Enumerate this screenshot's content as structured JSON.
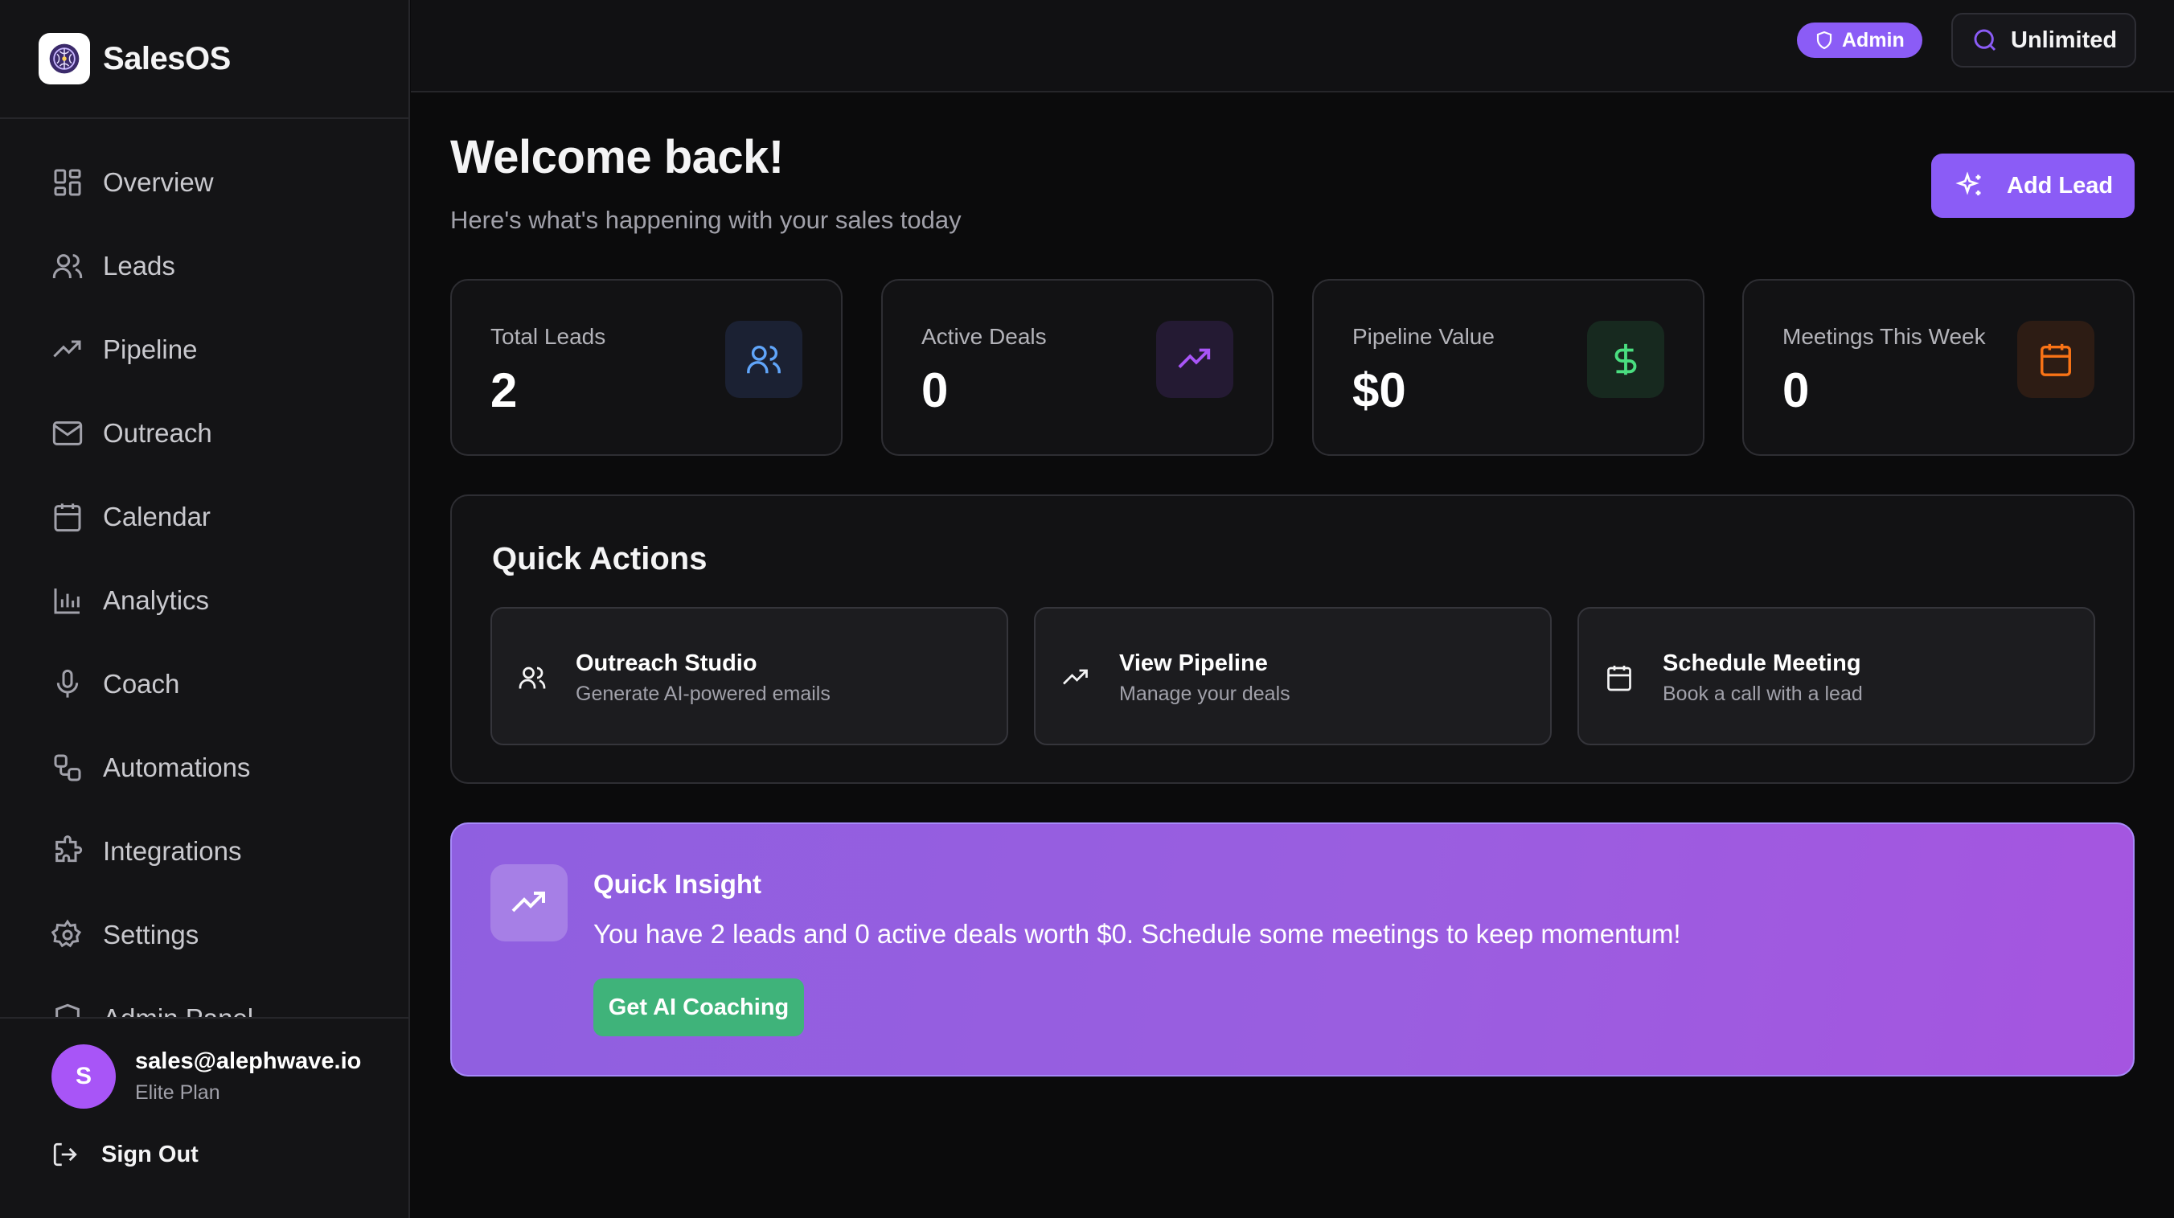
{
  "brand": {
    "name": "SalesOS",
    "logo_icon": "brain-logo-icon"
  },
  "sidebar": {
    "items": [
      {
        "label": "Overview",
        "icon": "grid-icon"
      },
      {
        "label": "Leads",
        "icon": "users-icon"
      },
      {
        "label": "Pipeline",
        "icon": "trending-up-icon"
      },
      {
        "label": "Outreach",
        "icon": "mail-icon"
      },
      {
        "label": "Calendar",
        "icon": "calendar-icon"
      },
      {
        "label": "Analytics",
        "icon": "bar-chart-icon"
      },
      {
        "label": "Coach",
        "icon": "microphone-icon"
      },
      {
        "label": "Automations",
        "icon": "workflow-icon"
      },
      {
        "label": "Integrations",
        "icon": "puzzle-icon"
      },
      {
        "label": "Settings",
        "icon": "gear-icon"
      },
      {
        "label": "Admin Panel",
        "icon": "shield-icon"
      }
    ]
  },
  "user": {
    "avatar_initial": "S",
    "email": "sales@alephwave.io",
    "plan": "Elite Plan"
  },
  "signout_label": "Sign Out",
  "topbar": {
    "admin_badge": "Admin",
    "unlimited_label": "Unlimited"
  },
  "header": {
    "title": "Welcome back!",
    "subtitle": "Here's what's happening with your sales today",
    "add_lead_label": "Add Lead"
  },
  "stats": [
    {
      "label": "Total Leads",
      "value": "2",
      "icon": "users-icon",
      "color": "#60a5fa"
    },
    {
      "label": "Active Deals",
      "value": "0",
      "icon": "trending-up-icon",
      "color": "#a855f7"
    },
    {
      "label": "Pipeline Value",
      "value": "$0",
      "icon": "dollar-icon",
      "color": "#4ade80"
    },
    {
      "label": "Meetings This Week",
      "value": "0",
      "icon": "calendar-icon",
      "color": "#f97316"
    }
  ],
  "quick_actions": {
    "title": "Quick Actions",
    "items": [
      {
        "label": "Outreach Studio",
        "desc": "Generate AI-powered emails",
        "icon": "users-icon"
      },
      {
        "label": "View Pipeline",
        "desc": "Manage your deals",
        "icon": "trending-up-icon"
      },
      {
        "label": "Schedule Meeting",
        "desc": "Book a call with a lead",
        "icon": "calendar-icon"
      }
    ]
  },
  "insight": {
    "title": "Quick Insight",
    "text": "You have 2 leads and 0 active deals worth $0. Schedule some meetings to keep momentum!",
    "button_label": "Get AI Coaching"
  },
  "colors": {
    "accent": "#8b5cf6",
    "success": "#3fb37a",
    "background": "#0b0b0c"
  }
}
